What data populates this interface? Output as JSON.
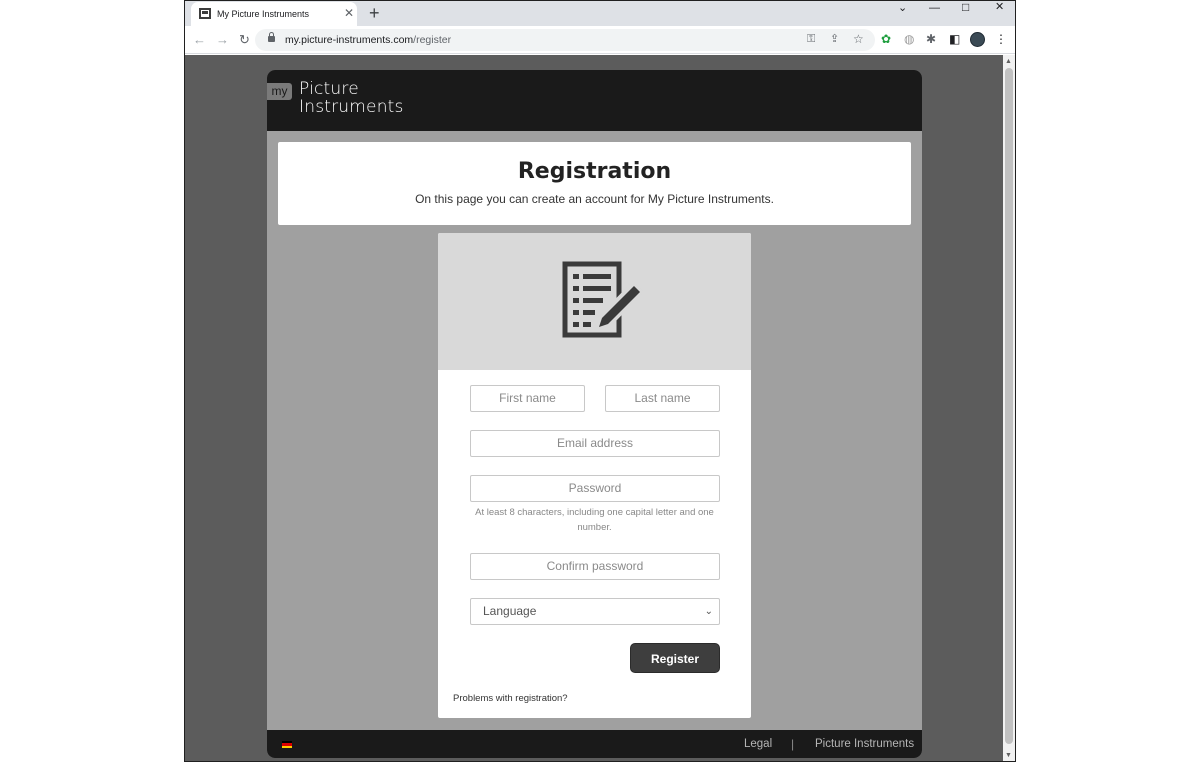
{
  "browser": {
    "tab_title": "My Picture Instruments",
    "tab_close": "✕",
    "new_tab": "+",
    "window_controls": {
      "dropdown": "⌄",
      "minimize": "—",
      "maximize": "□",
      "close": "✕"
    },
    "nav": {
      "back": "←",
      "forward": "→",
      "reload": "↻"
    },
    "url_host": "my.picture-instruments.com",
    "url_path": "/register",
    "omnibox_icons": {
      "key": "⚿",
      "share": "⇪",
      "star": "☆"
    },
    "toolbar_icons": {
      "extension_green": "✿",
      "extension_globe": "◍",
      "extensions_puzzle": "✱",
      "sidepanel": "◧",
      "menu": "⋮"
    }
  },
  "site": {
    "logo_badge": "my",
    "logo_line1": "Picture",
    "logo_line2": "Instruments",
    "page_title": "Registration",
    "page_subtitle": "On this page you can create an account for My Picture Instruments.",
    "form": {
      "first_name_placeholder": "First name",
      "last_name_placeholder": "Last name",
      "email_placeholder": "Email address",
      "password_placeholder": "Password",
      "password_hint": "At least 8 characters, including one capital letter and one number.",
      "confirm_password_placeholder": "Confirm password",
      "language_selected": "Language",
      "language_chevron": "⌄",
      "register_label": "Register",
      "problems_link": "Problems with registration?"
    },
    "footer": {
      "flag_colors": [
        "#000000",
        "#dd0000",
        "#ffce00"
      ],
      "legal_link": "Legal",
      "separator": "|",
      "brand_link": "Picture Instruments"
    }
  },
  "colors": {
    "header_bg": "#1a1a1a",
    "page_bg": "#a0a0a0",
    "button_bg": "#3e3e3e",
    "card_header_bg": "#d9d9d9"
  }
}
